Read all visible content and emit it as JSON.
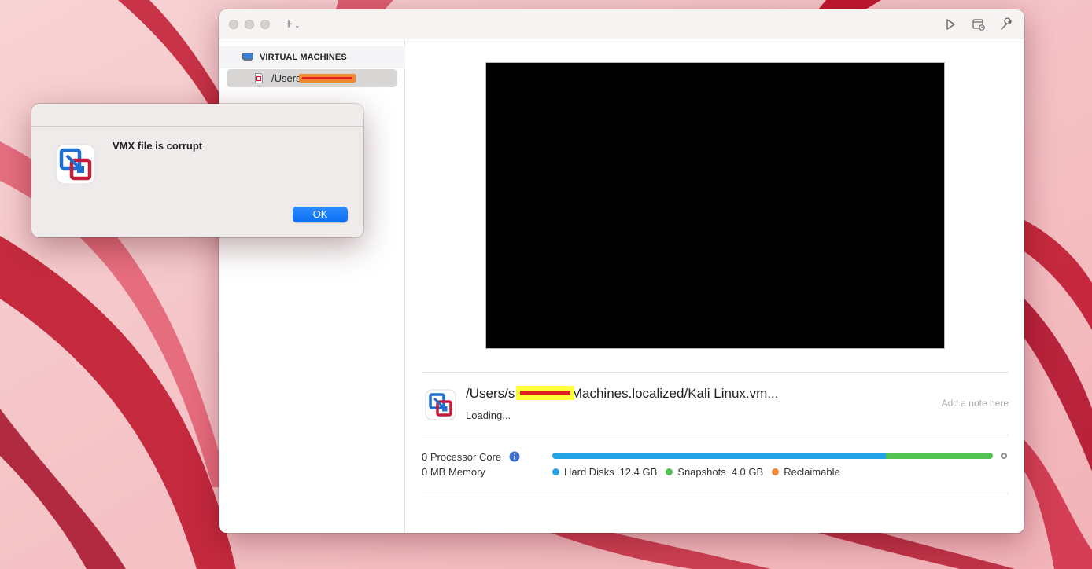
{
  "window": {
    "toolbar": {
      "add_label": "+",
      "add_chevron": "⌄",
      "play_icon": "play-icon",
      "snapshot_icon": "snapshot-icon",
      "settings_icon": "wrench-icon"
    }
  },
  "sidebar": {
    "section_label": "VIRTUAL MACHINES",
    "items": [
      {
        "label": "/Users/s          h/Virt...",
        "icon": "vmx-file-icon",
        "redacted": true
      }
    ]
  },
  "vm_details": {
    "path": "/Users/s          h/Virtual Machines.localized/Kali Linux.vm...",
    "status": "Loading...",
    "note_placeholder": "Add a note here",
    "processor": "0 Processor Core",
    "memory": "0 MB Memory",
    "storage": {
      "legend": [
        {
          "label": "Hard Disks",
          "value": "12.4 GB",
          "color": "#22a3e6"
        },
        {
          "label": "Snapshots",
          "value": "4.0 GB",
          "color": "#52c252"
        },
        {
          "label": "Reclaimable",
          "value": "",
          "color": "#f0883a"
        }
      ]
    }
  },
  "alert": {
    "message": "VMX file is corrupt",
    "ok_label": "OK"
  },
  "colors": {
    "accent": "#0a6ef2",
    "preview_bg": "#000000",
    "redaction_red": "#e0201f",
    "redaction_yellow": "#ffff3a",
    "redaction_orange": "#f08a2e"
  }
}
